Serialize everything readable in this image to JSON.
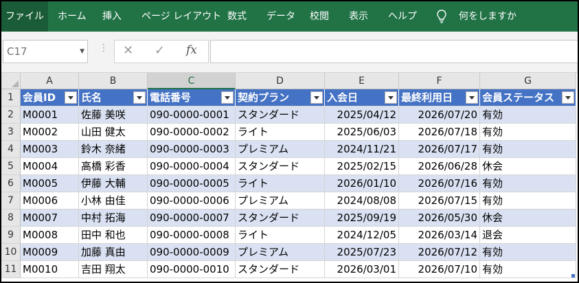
{
  "ribbon": {
    "tabs": [
      {
        "label": "ファイル",
        "active": true
      },
      {
        "label": "ホーム"
      },
      {
        "label": "挿入"
      },
      {
        "label": "ページ レイアウト"
      },
      {
        "label": "数式"
      },
      {
        "label": "データ"
      },
      {
        "label": "校閲"
      },
      {
        "label": "表示"
      },
      {
        "label": "ヘルプ"
      }
    ],
    "tell_me": "何をしますか",
    "tell_me_icon": "lightbulb-icon"
  },
  "formula_bar": {
    "name_box": "C17",
    "cancel_icon": "close-icon",
    "enter_icon": "check-icon",
    "fx_label": "fx",
    "value": ""
  },
  "sheet": {
    "columns": [
      "A",
      "B",
      "C",
      "D",
      "E",
      "F",
      "G"
    ],
    "selected_column": "C",
    "rows": [
      "1",
      "2",
      "3",
      "4",
      "5",
      "6",
      "7",
      "8",
      "9",
      "10",
      "11"
    ],
    "table": {
      "headers": [
        "会員ID",
        "氏名",
        "電話番号",
        "契約プラン",
        "入会日",
        "最終利用日",
        "会員ステータス"
      ],
      "data": [
        [
          "M0001",
          "佐藤 美咲",
          "090-0000-0001",
          "スタンダード",
          "2025/04/12",
          "2026/07/20",
          "有効"
        ],
        [
          "M0002",
          "山田 健太",
          "090-0000-0002",
          "ライト",
          "2025/06/03",
          "2026/07/18",
          "有効"
        ],
        [
          "M0003",
          "鈴木 奈緒",
          "090-0000-0003",
          "プレミアム",
          "2024/11/21",
          "2026/07/17",
          "有効"
        ],
        [
          "M0004",
          "高橋 彩香",
          "090-0000-0004",
          "スタンダード",
          "2025/02/15",
          "2026/06/28",
          "休会"
        ],
        [
          "M0005",
          "伊藤 大輔",
          "090-0000-0005",
          "ライト",
          "2026/01/10",
          "2026/07/16",
          "有効"
        ],
        [
          "M0006",
          "小林 由佳",
          "090-0000-0006",
          "プレミアム",
          "2024/08/08",
          "2026/07/15",
          "有効"
        ],
        [
          "M0007",
          "中村 拓海",
          "090-0000-0007",
          "スタンダード",
          "2025/09/19",
          "2026/05/30",
          "休会"
        ],
        [
          "M0008",
          "田中 和也",
          "090-0000-0008",
          "ライト",
          "2024/12/05",
          "2026/03/14",
          "退会"
        ],
        [
          "M0009",
          "加藤 真由",
          "090-0000-0009",
          "プレミアム",
          "2025/07/23",
          "2026/07/12",
          "有効"
        ],
        [
          "M0010",
          "吉田 翔太",
          "090-0000-0010",
          "スタンダード",
          "2026/03/01",
          "2026/07/10",
          "有効"
        ]
      ]
    },
    "colors": {
      "ribbon": "#217346",
      "header_fill": "#4472c4",
      "band_fill": "#d9e1f2"
    }
  }
}
